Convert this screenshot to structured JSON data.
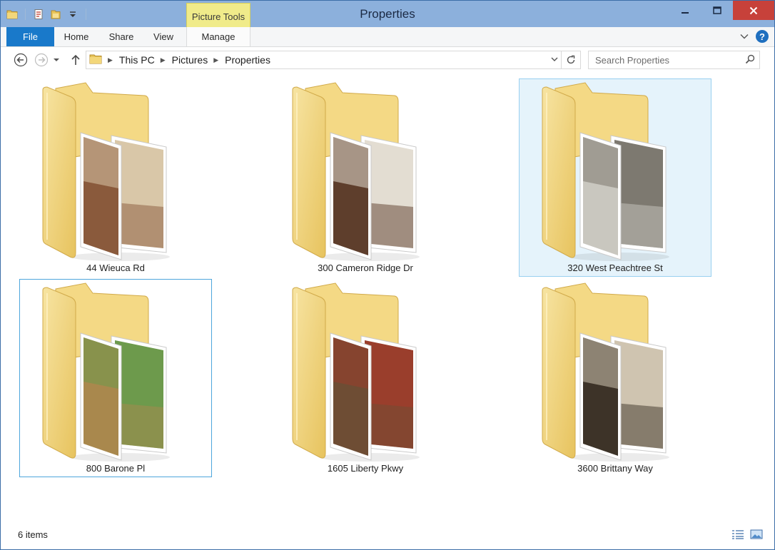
{
  "window": {
    "title": "Properties",
    "context_tab": "Picture Tools",
    "controls": [
      "minimize-icon",
      "maximize-icon",
      "close-icon"
    ]
  },
  "quick_access": [
    "folder-icon",
    "properties-icon",
    "new-folder-icon",
    "customize-dropdown-icon"
  ],
  "ribbon": {
    "tabs": [
      "File",
      "Home",
      "Share",
      "View",
      "Manage"
    ],
    "help_label": "?"
  },
  "address": {
    "breadcrumb": [
      "This PC",
      "Pictures",
      "Properties"
    ],
    "search_placeholder": "Search Properties"
  },
  "items": [
    {
      "name": "44 Wieuca Rd",
      "state": "normal",
      "photo_colors": [
        "#8a5a3c",
        "#d9c7a8"
      ]
    },
    {
      "name": "300 Cameron Ridge Dr",
      "state": "normal",
      "photo_colors": [
        "#5e3e2c",
        "#e3ddd2"
      ]
    },
    {
      "name": "320 West Peachtree St",
      "state": "selected",
      "photo_colors": [
        "#c9c7bf",
        "#7d7970"
      ]
    },
    {
      "name": "800 Barone Pl",
      "state": "focused",
      "photo_colors": [
        "#a9884d",
        "#6d9a4c"
      ]
    },
    {
      "name": "1605 Liberty Pkwy",
      "state": "normal",
      "photo_colors": [
        "#6e4d34",
        "#9a3e2c"
      ]
    },
    {
      "name": "3600 Brittany Way",
      "state": "normal",
      "photo_colors": [
        "#3d3328",
        "#cfc4b0"
      ]
    }
  ],
  "status": {
    "item_count": "6 items",
    "view_icons": [
      "details-view-icon",
      "large-icons-view-icon"
    ]
  }
}
